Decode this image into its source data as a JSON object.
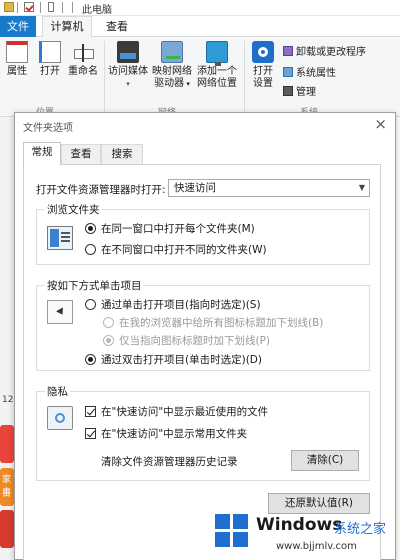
{
  "explorer": {
    "window_title": "此电脑",
    "tabs": {
      "file": "文件",
      "computer": "计算机",
      "view": "查看"
    },
    "ribbon": {
      "properties": "属性",
      "open": "打开",
      "rename": "重命名",
      "media_access_1": "访问媒体",
      "map_drive_1": "映射网络",
      "map_drive_2": "驱动器",
      "add_location_1": "添加一个",
      "add_location_2": "网络位置",
      "open_settings_1": "打开",
      "open_settings_2": "设置",
      "uninstall": "卸载或更改程序",
      "system_props": "系统属性",
      "manage": "管理",
      "group_location": "位置",
      "group_network": "网络",
      "group_system": "系统"
    },
    "left_strip": {
      "number": "12",
      "tile_text_1": "家丰",
      "tile_text_2": "日"
    }
  },
  "dialog": {
    "title": "文件夹选项",
    "close": "×",
    "tabs": [
      "常规",
      "查看",
      "搜索"
    ],
    "open_explorer_label": "打开文件资源管理器时打开:",
    "open_explorer_value": "快速访问",
    "browse_group": {
      "title": "浏览文件夹",
      "options": [
        "在同一窗口中打开每个文件夹(M)",
        "在不同窗口中打开不同的文件夹(W)"
      ],
      "selected_index": 0
    },
    "click_group": {
      "title": "按如下方式单击项目",
      "single_click": "通过单击打开项目(指向时选定)(S)",
      "sub_options": [
        "在我的浏览器中给所有图标标题加下划线(B)",
        "仅当指向图标标题时加下划线(P)"
      ],
      "double_click": "通过双击打开项目(单击时选定)(D)",
      "selected": "double_click"
    },
    "privacy_group": {
      "title": "隐私",
      "checks": [
        {
          "label": "在\"快速访问\"中显示最近使用的文件",
          "checked": true
        },
        {
          "label": "在\"快速访问\"中显示常用文件夹",
          "checked": true
        }
      ],
      "clear_label": "清除文件资源管理器历史记录",
      "clear_button": "清除(C)"
    },
    "restore_defaults": "还原默认值(R)"
  },
  "watermark": {
    "brand": "Windows",
    "site_cn": "系统之家",
    "url": "www.bjjmlv.com"
  },
  "colors": {
    "accent": "#1979ca",
    "windows_blue": "#1e6fd0"
  }
}
